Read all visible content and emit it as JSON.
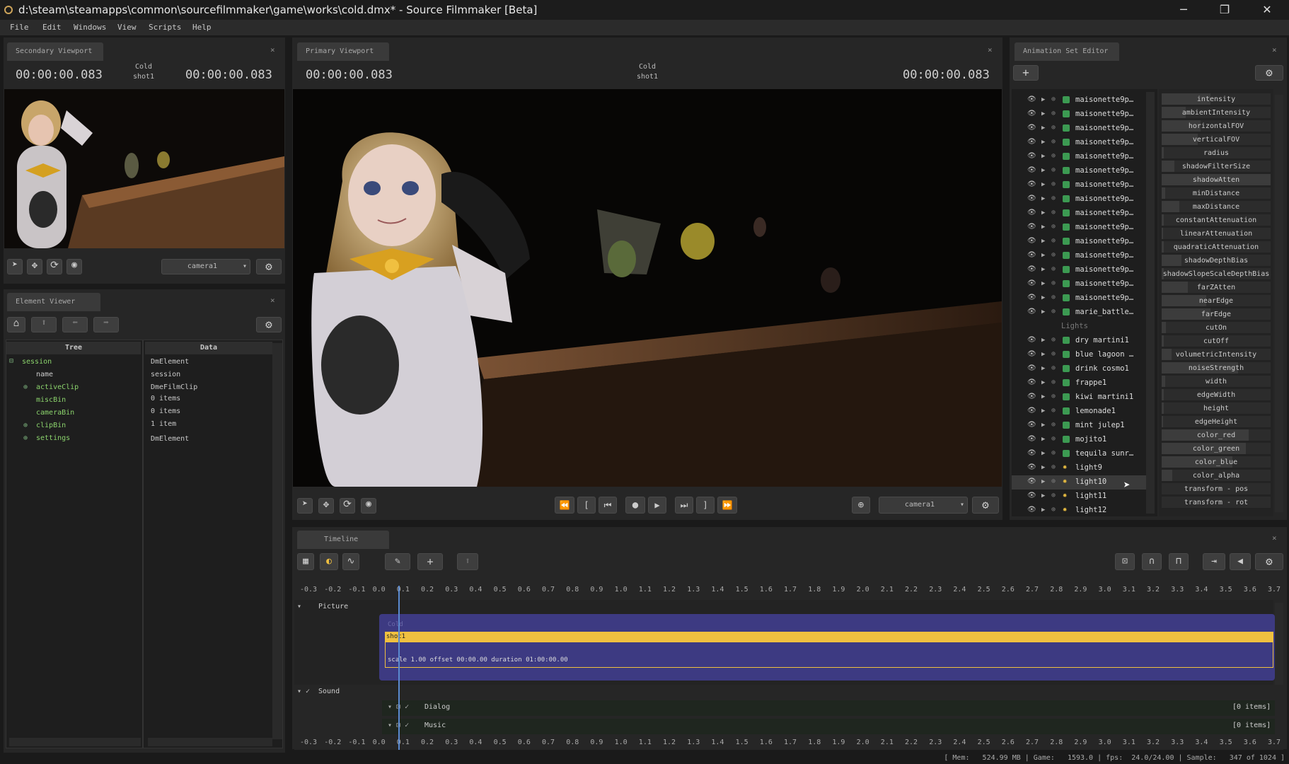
{
  "window": {
    "title": "d:\\steam\\steamapps\\common\\sourcefilmmaker\\game\\works\\cold.dmx* - Source Filmmaker [Beta]",
    "minimize": "─",
    "restore": "❐",
    "close": "✕"
  },
  "menu": [
    "File",
    "Edit",
    "Windows",
    "View",
    "Scripts",
    "Help"
  ],
  "secondary": {
    "tab": "Secondary Viewport",
    "close": "×",
    "tc_left": "00:00:00.083",
    "tc_right": "00:00:00.083",
    "clip_name": "Cold",
    "shot_name": "shot1",
    "camera": "camera1"
  },
  "primary": {
    "tab": "Primary Viewport",
    "close": "×",
    "tc_left": "00:00:00.083",
    "tc_right": "00:00:00.083",
    "clip_name": "Cold",
    "shot_name": "shot1",
    "camera": "camera1"
  },
  "element_viewer": {
    "tab": "Element Viewer",
    "close": "×",
    "tree_header": "Tree",
    "data_header": "Data",
    "tree": [
      "session",
      "name",
      "activeClip",
      "miscBin",
      "cameraBin",
      "clipBin",
      "settings"
    ],
    "data": [
      "DmElement",
      "session",
      "DmeFilmClip",
      "0 items",
      "0 items",
      "1 item",
      "DmElement"
    ]
  },
  "ase": {
    "tab": "Animation Set Editor",
    "close": "×",
    "add": "+",
    "items": [
      {
        "label": "maisonette9p…",
        "type": "model"
      },
      {
        "label": "maisonette9p…",
        "type": "model"
      },
      {
        "label": "maisonette9p…",
        "type": "model"
      },
      {
        "label": "maisonette9p…",
        "type": "model"
      },
      {
        "label": "maisonette9p…",
        "type": "model"
      },
      {
        "label": "maisonette9p…",
        "type": "model"
      },
      {
        "label": "maisonette9p…",
        "type": "model"
      },
      {
        "label": "maisonette9p…",
        "type": "model"
      },
      {
        "label": "maisonette9p…",
        "type": "model"
      },
      {
        "label": "maisonette9p…",
        "type": "model"
      },
      {
        "label": "maisonette9p…",
        "type": "model"
      },
      {
        "label": "maisonette9p…",
        "type": "model"
      },
      {
        "label": "maisonette9p…",
        "type": "model"
      },
      {
        "label": "maisonette9p…",
        "type": "model"
      },
      {
        "label": "maisonette9p…",
        "type": "model"
      },
      {
        "label": "marie_battle…",
        "type": "model"
      },
      {
        "label": "Lights",
        "type": "group"
      },
      {
        "label": "dry martini1",
        "type": "model"
      },
      {
        "label": "blue lagoon …",
        "type": "model"
      },
      {
        "label": "drink cosmo1",
        "type": "model"
      },
      {
        "label": "frappe1",
        "type": "model"
      },
      {
        "label": "kiwi martini1",
        "type": "model"
      },
      {
        "label": "lemonade1",
        "type": "model"
      },
      {
        "label": "mint julep1",
        "type": "model"
      },
      {
        "label": "mojito1",
        "type": "model"
      },
      {
        "label": "tequila sunr…",
        "type": "model"
      },
      {
        "label": "light9",
        "type": "light"
      },
      {
        "label": "light10",
        "type": "light"
      },
      {
        "label": "light11",
        "type": "light"
      },
      {
        "label": "light12",
        "type": "light"
      }
    ],
    "props": [
      "intensity",
      "ambientIntensity",
      "horizontalFOV",
      "verticalFOV",
      "radius",
      "shadowFilterSize",
      "shadowAtten",
      "minDistance",
      "maxDistance",
      "constantAttenuation",
      "linearAttenuation",
      "quadraticAttenuation",
      "shadowDepthBias",
      "shadowSlopeScaleDepthBias",
      "farZAtten",
      "nearEdge",
      "farEdge",
      "cutOn",
      "cutOff",
      "volumetricIntensity",
      "noiseStrength",
      "width",
      "edgeWidth",
      "height",
      "edgeHeight",
      "color_red",
      "color_green",
      "color_blue",
      "color_alpha",
      "transform - pos",
      "transform - rot"
    ],
    "prop_levels": [
      0.45,
      0.22,
      0.36,
      0.33,
      0.02,
      0.12,
      1.0,
      0.03,
      0.16,
      0.02,
      0.01,
      0.02,
      0.18,
      0.02,
      0.24,
      0.41,
      0.45,
      0.04,
      0.02,
      0.09,
      0.7,
      0.03,
      0.02,
      0.02,
      0.01,
      0.8,
      0.77,
      0.65,
      0.1,
      0,
      0
    ]
  },
  "timeline": {
    "tab": "Timeline",
    "close": "×",
    "ticks": [
      "-0.3",
      "-0.2",
      "-0.1",
      "0.0",
      "0.1",
      "0.2",
      "0.3",
      "0.4",
      "0.5",
      "0.6",
      "0.7",
      "0.8",
      "0.9",
      "1.0",
      "1.1",
      "1.2",
      "1.3",
      "1.4",
      "1.5",
      "1.6",
      "1.7",
      "1.8",
      "1.9",
      "2.0",
      "2.1",
      "2.2",
      "2.3",
      "2.4",
      "2.5",
      "2.6",
      "2.7",
      "2.8",
      "2.9",
      "3.0",
      "3.1",
      "3.2",
      "3.3",
      "3.4",
      "3.5",
      "3.6",
      "3.7"
    ],
    "playhead": 0.083,
    "picture_label": "Picture",
    "clip_label": "Cold",
    "shot_label": "shot1",
    "shot_info": "scale 1.00 offset  00:00.00 duration  01:00:00.00",
    "sound_label": "Sound",
    "tracks": [
      {
        "name": "Dialog",
        "count": "[0 items]"
      },
      {
        "name": "Music",
        "count": "[0 items]"
      }
    ]
  },
  "status": "[ Mem:   524.99 MB | Game:   1593.0 | fps:  24.0/24.00 | Sample:   347 of 1024 ]",
  "colors": {
    "accent": "#f0c040",
    "shot_bg": "#3d3a82",
    "track_green": "#3c9a52"
  }
}
